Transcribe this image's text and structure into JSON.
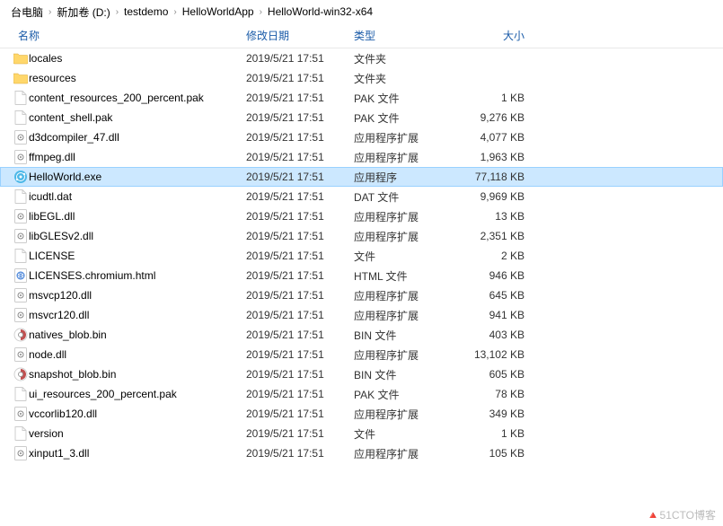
{
  "breadcrumb": {
    "items": [
      "台电脑",
      "新加卷 (D:)",
      "testdemo",
      "HelloWorldApp",
      "HelloWorld-win32-x64"
    ]
  },
  "columns": {
    "name": "名称",
    "modified": "修改日期",
    "type": "类型",
    "size": "大小"
  },
  "files": [
    {
      "icon": "folder",
      "name": "locales",
      "date": "2019/5/21 17:51",
      "type": "文件夹",
      "size": "",
      "selected": false
    },
    {
      "icon": "folder",
      "name": "resources",
      "date": "2019/5/21 17:51",
      "type": "文件夹",
      "size": "",
      "selected": false
    },
    {
      "icon": "file",
      "name": "content_resources_200_percent.pak",
      "date": "2019/5/21 17:51",
      "type": "PAK 文件",
      "size": "1 KB",
      "selected": false
    },
    {
      "icon": "file",
      "name": "content_shell.pak",
      "date": "2019/5/21 17:51",
      "type": "PAK 文件",
      "size": "9,276 KB",
      "selected": false
    },
    {
      "icon": "dll",
      "name": "d3dcompiler_47.dll",
      "date": "2019/5/21 17:51",
      "type": "应用程序扩展",
      "size": "4,077 KB",
      "selected": false
    },
    {
      "icon": "dll",
      "name": "ffmpeg.dll",
      "date": "2019/5/21 17:51",
      "type": "应用程序扩展",
      "size": "1,963 KB",
      "selected": false
    },
    {
      "icon": "exe",
      "name": "HelloWorld.exe",
      "date": "2019/5/21 17:51",
      "type": "应用程序",
      "size": "77,118 KB",
      "selected": true
    },
    {
      "icon": "file",
      "name": "icudtl.dat",
      "date": "2019/5/21 17:51",
      "type": "DAT 文件",
      "size": "9,969 KB",
      "selected": false
    },
    {
      "icon": "dll",
      "name": "libEGL.dll",
      "date": "2019/5/21 17:51",
      "type": "应用程序扩展",
      "size": "13 KB",
      "selected": false
    },
    {
      "icon": "dll",
      "name": "libGLESv2.dll",
      "date": "2019/5/21 17:51",
      "type": "应用程序扩展",
      "size": "2,351 KB",
      "selected": false
    },
    {
      "icon": "file",
      "name": "LICENSE",
      "date": "2019/5/21 17:51",
      "type": "文件",
      "size": "2 KB",
      "selected": false
    },
    {
      "icon": "html",
      "name": "LICENSES.chromium.html",
      "date": "2019/5/21 17:51",
      "type": "HTML 文件",
      "size": "946 KB",
      "selected": false
    },
    {
      "icon": "dll",
      "name": "msvcp120.dll",
      "date": "2019/5/21 17:51",
      "type": "应用程序扩展",
      "size": "645 KB",
      "selected": false
    },
    {
      "icon": "dll",
      "name": "msvcr120.dll",
      "date": "2019/5/21 17:51",
      "type": "应用程序扩展",
      "size": "941 KB",
      "selected": false
    },
    {
      "icon": "bin",
      "name": "natives_blob.bin",
      "date": "2019/5/21 17:51",
      "type": "BIN 文件",
      "size": "403 KB",
      "selected": false
    },
    {
      "icon": "dll",
      "name": "node.dll",
      "date": "2019/5/21 17:51",
      "type": "应用程序扩展",
      "size": "13,102 KB",
      "selected": false
    },
    {
      "icon": "bin",
      "name": "snapshot_blob.bin",
      "date": "2019/5/21 17:51",
      "type": "BIN 文件",
      "size": "605 KB",
      "selected": false
    },
    {
      "icon": "file",
      "name": "ui_resources_200_percent.pak",
      "date": "2019/5/21 17:51",
      "type": "PAK 文件",
      "size": "78 KB",
      "selected": false
    },
    {
      "icon": "dll",
      "name": "vccorlib120.dll",
      "date": "2019/5/21 17:51",
      "type": "应用程序扩展",
      "size": "349 KB",
      "selected": false
    },
    {
      "icon": "file",
      "name": "version",
      "date": "2019/5/21 17:51",
      "type": "文件",
      "size": "1 KB",
      "selected": false
    },
    {
      "icon": "dll",
      "name": "xinput1_3.dll",
      "date": "2019/5/21 17:51",
      "type": "应用程序扩展",
      "size": "105 KB",
      "selected": false
    }
  ],
  "watermark": "🔺51CTO博客"
}
